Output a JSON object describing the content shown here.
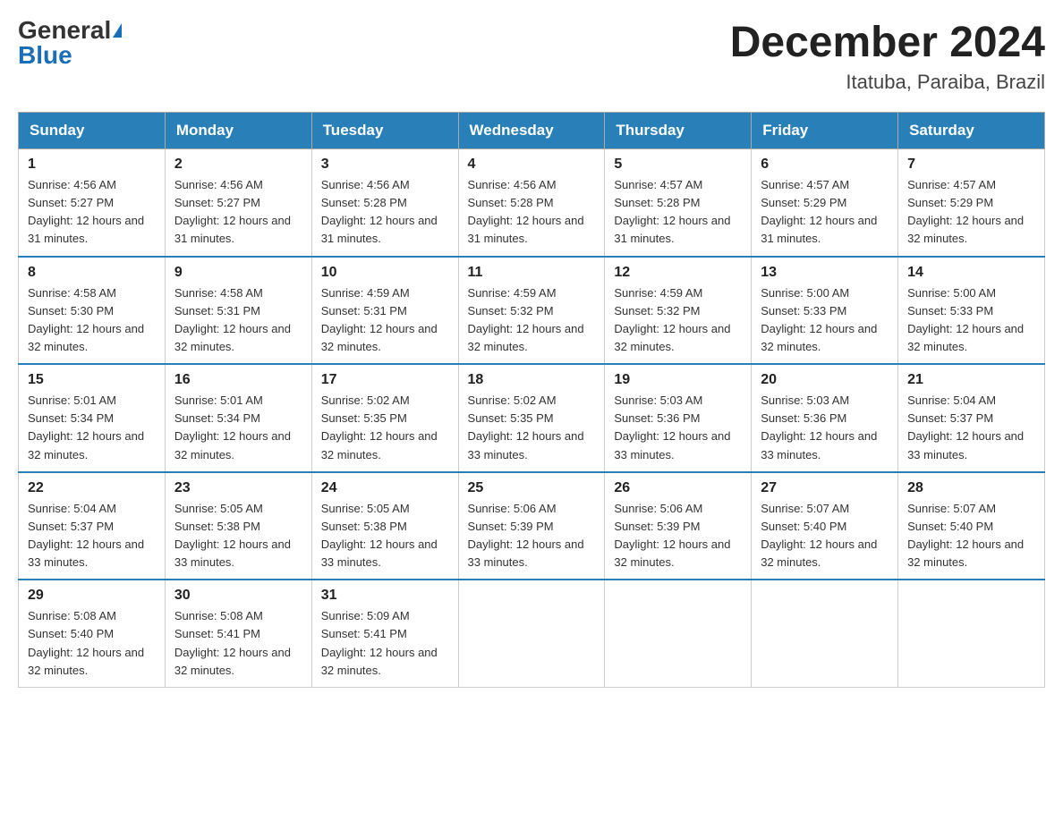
{
  "logo": {
    "general": "General",
    "blue": "Blue"
  },
  "title": {
    "month_year": "December 2024",
    "location": "Itatuba, Paraiba, Brazil"
  },
  "headers": [
    "Sunday",
    "Monday",
    "Tuesday",
    "Wednesday",
    "Thursday",
    "Friday",
    "Saturday"
  ],
  "weeks": [
    [
      {
        "day": "1",
        "sunrise": "4:56 AM",
        "sunset": "5:27 PM",
        "daylight": "12 hours and 31 minutes."
      },
      {
        "day": "2",
        "sunrise": "4:56 AM",
        "sunset": "5:27 PM",
        "daylight": "12 hours and 31 minutes."
      },
      {
        "day": "3",
        "sunrise": "4:56 AM",
        "sunset": "5:28 PM",
        "daylight": "12 hours and 31 minutes."
      },
      {
        "day": "4",
        "sunrise": "4:56 AM",
        "sunset": "5:28 PM",
        "daylight": "12 hours and 31 minutes."
      },
      {
        "day": "5",
        "sunrise": "4:57 AM",
        "sunset": "5:28 PM",
        "daylight": "12 hours and 31 minutes."
      },
      {
        "day": "6",
        "sunrise": "4:57 AM",
        "sunset": "5:29 PM",
        "daylight": "12 hours and 31 minutes."
      },
      {
        "day": "7",
        "sunrise": "4:57 AM",
        "sunset": "5:29 PM",
        "daylight": "12 hours and 32 minutes."
      }
    ],
    [
      {
        "day": "8",
        "sunrise": "4:58 AM",
        "sunset": "5:30 PM",
        "daylight": "12 hours and 32 minutes."
      },
      {
        "day": "9",
        "sunrise": "4:58 AM",
        "sunset": "5:31 PM",
        "daylight": "12 hours and 32 minutes."
      },
      {
        "day": "10",
        "sunrise": "4:59 AM",
        "sunset": "5:31 PM",
        "daylight": "12 hours and 32 minutes."
      },
      {
        "day": "11",
        "sunrise": "4:59 AM",
        "sunset": "5:32 PM",
        "daylight": "12 hours and 32 minutes."
      },
      {
        "day": "12",
        "sunrise": "4:59 AM",
        "sunset": "5:32 PM",
        "daylight": "12 hours and 32 minutes."
      },
      {
        "day": "13",
        "sunrise": "5:00 AM",
        "sunset": "5:33 PM",
        "daylight": "12 hours and 32 minutes."
      },
      {
        "day": "14",
        "sunrise": "5:00 AM",
        "sunset": "5:33 PM",
        "daylight": "12 hours and 32 minutes."
      }
    ],
    [
      {
        "day": "15",
        "sunrise": "5:01 AM",
        "sunset": "5:34 PM",
        "daylight": "12 hours and 32 minutes."
      },
      {
        "day": "16",
        "sunrise": "5:01 AM",
        "sunset": "5:34 PM",
        "daylight": "12 hours and 32 minutes."
      },
      {
        "day": "17",
        "sunrise": "5:02 AM",
        "sunset": "5:35 PM",
        "daylight": "12 hours and 32 minutes."
      },
      {
        "day": "18",
        "sunrise": "5:02 AM",
        "sunset": "5:35 PM",
        "daylight": "12 hours and 33 minutes."
      },
      {
        "day": "19",
        "sunrise": "5:03 AM",
        "sunset": "5:36 PM",
        "daylight": "12 hours and 33 minutes."
      },
      {
        "day": "20",
        "sunrise": "5:03 AM",
        "sunset": "5:36 PM",
        "daylight": "12 hours and 33 minutes."
      },
      {
        "day": "21",
        "sunrise": "5:04 AM",
        "sunset": "5:37 PM",
        "daylight": "12 hours and 33 minutes."
      }
    ],
    [
      {
        "day": "22",
        "sunrise": "5:04 AM",
        "sunset": "5:37 PM",
        "daylight": "12 hours and 33 minutes."
      },
      {
        "day": "23",
        "sunrise": "5:05 AM",
        "sunset": "5:38 PM",
        "daylight": "12 hours and 33 minutes."
      },
      {
        "day": "24",
        "sunrise": "5:05 AM",
        "sunset": "5:38 PM",
        "daylight": "12 hours and 33 minutes."
      },
      {
        "day": "25",
        "sunrise": "5:06 AM",
        "sunset": "5:39 PM",
        "daylight": "12 hours and 33 minutes."
      },
      {
        "day": "26",
        "sunrise": "5:06 AM",
        "sunset": "5:39 PM",
        "daylight": "12 hours and 32 minutes."
      },
      {
        "day": "27",
        "sunrise": "5:07 AM",
        "sunset": "5:40 PM",
        "daylight": "12 hours and 32 minutes."
      },
      {
        "day": "28",
        "sunrise": "5:07 AM",
        "sunset": "5:40 PM",
        "daylight": "12 hours and 32 minutes."
      }
    ],
    [
      {
        "day": "29",
        "sunrise": "5:08 AM",
        "sunset": "5:40 PM",
        "daylight": "12 hours and 32 minutes."
      },
      {
        "day": "30",
        "sunrise": "5:08 AM",
        "sunset": "5:41 PM",
        "daylight": "12 hours and 32 minutes."
      },
      {
        "day": "31",
        "sunrise": "5:09 AM",
        "sunset": "5:41 PM",
        "daylight": "12 hours and 32 minutes."
      },
      null,
      null,
      null,
      null
    ]
  ]
}
